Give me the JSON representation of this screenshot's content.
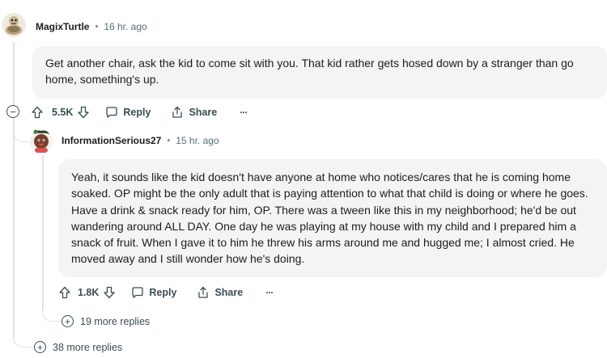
{
  "comment1": {
    "username": "MagixTurtle",
    "separator": "•",
    "time": "16 hr. ago",
    "body": "Get another chair, ask the kid to come sit with you. That kid rather gets hosed down by a stranger than go home, something's up.",
    "votes": "5.5K",
    "reply_label": "Reply",
    "share_label": "Share",
    "overflow_label": "···"
  },
  "comment2": {
    "username": "InformationSerious27",
    "separator": "•",
    "time": "15 hr. ago",
    "body": "Yeah, it sounds like the kid doesn't have anyone at home who notices/cares that he is coming home soaked. OP might be the only adult that is paying attention to what that child is doing or where he goes. Have a drink & snack ready for him, OP. There was a tween like this in my neighborhood; he'd be out wandering around ALL DAY. One day he was playing at my house with my child and I prepared him a snack of fruit. When I gave it to him he threw his arms around me and hugged me; I almost cried. He moved away and I still wonder how he's doing.",
    "votes": "1.8K",
    "reply_label": "Reply",
    "share_label": "Share",
    "overflow_label": "···",
    "more_replies": "19 more replies"
  },
  "thread": {
    "collapse_symbol": "−",
    "expand_symbol": "+",
    "more_replies": "38 more replies"
  },
  "colors": {
    "bubble": "#f3f4f6",
    "thread_line": "#dfe3e6",
    "text": "#1c1c1c",
    "muted": "#576f76",
    "action": "#3b4b52"
  },
  "icons": [
    "avatar-turtle",
    "avatar-character",
    "upvote-icon",
    "downvote-icon",
    "comment-icon",
    "share-icon",
    "overflow-icon",
    "collapse-icon",
    "expand-icon"
  ]
}
